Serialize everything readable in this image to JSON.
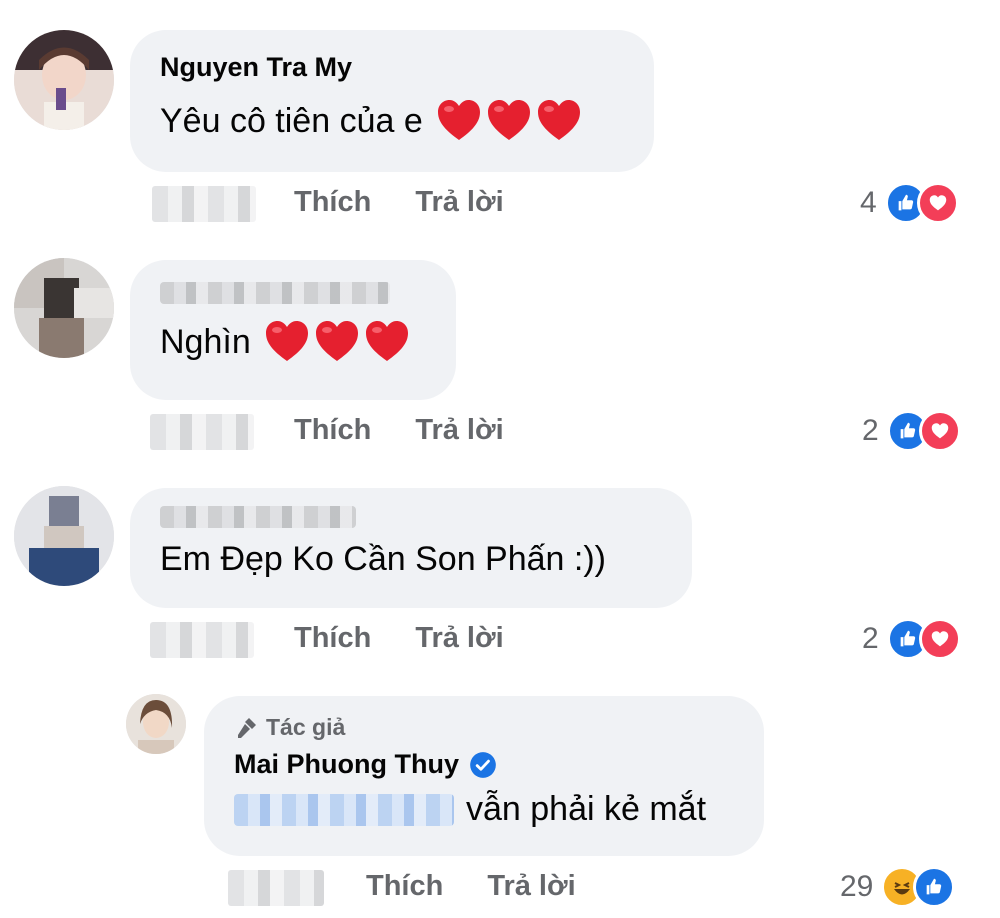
{
  "comments": [
    {
      "author": "Nguyen Tra My",
      "text": "Yêu cô tiên của e",
      "like_label": "Thích",
      "reply_label": "Trả lời",
      "reaction_count": "4"
    },
    {
      "author": "",
      "text": "Nghìn",
      "like_label": "Thích",
      "reply_label": "Trả lời",
      "reaction_count": "2"
    },
    {
      "author": "",
      "text": "Em Đẹp Ko Cần Son Phấn :))",
      "like_label": "Thích",
      "reply_label": "Trả lời",
      "reaction_count": "2"
    }
  ],
  "reply": {
    "badge": "Tác giả",
    "author": "Mai Phuong Thuy",
    "text": "vẫn phải kẻ mắt",
    "like_label": "Thích",
    "reply_label": "Trả lời",
    "reaction_count": "29"
  },
  "colors": {
    "bubble": "#f0f2f5",
    "meta_text": "#65676b",
    "like": "#1b74e4",
    "love": "#f33e58",
    "haha": "#f7b125"
  },
  "icons": [
    "heart-emoji",
    "like-reaction-icon",
    "love-reaction-icon",
    "haha-reaction-icon",
    "verified-icon",
    "author-mic-icon"
  ]
}
